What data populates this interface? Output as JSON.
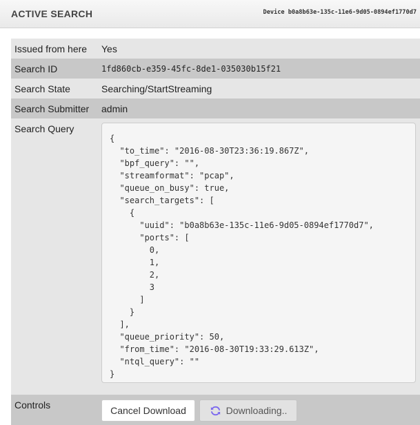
{
  "header": {
    "title": "ACTIVE SEARCH",
    "device": "Device b0a8b63e-135c-11e6-9d05-0894ef1770d7"
  },
  "details": {
    "issued_label": "Issued from here",
    "issued_value": "Yes",
    "search_id_label": "Search ID",
    "search_id_value": "1fd860cb-e359-45fc-8de1-035030b15f21",
    "state_label": "Search State",
    "state_value": "Searching/StartStreaming",
    "submitter_label": "Search Submitter",
    "submitter_value": "admin",
    "query_label": "Search Query",
    "query_value": "{\n  \"to_time\": \"2016-08-30T23:36:19.867Z\",\n  \"bpf_query\": \"\",\n  \"streamformat\": \"pcap\",\n  \"queue_on_busy\": true,\n  \"search_targets\": [\n    {\n      \"uuid\": \"b0a8b63e-135c-11e6-9d05-0894ef1770d7\",\n      \"ports\": [\n        0,\n        1,\n        2,\n        3\n      ]\n    }\n  ],\n  \"queue_priority\": 50,\n  \"from_time\": \"2016-08-30T19:33:29.613Z\",\n  \"ntql_query\": \"\"\n}",
    "controls_label": "Controls"
  },
  "controls": {
    "cancel_label": "Cancel Download",
    "downloading_label": "Downloading..",
    "spinner_icon": "refresh-icon",
    "spinner_color": "#7b68ee"
  }
}
